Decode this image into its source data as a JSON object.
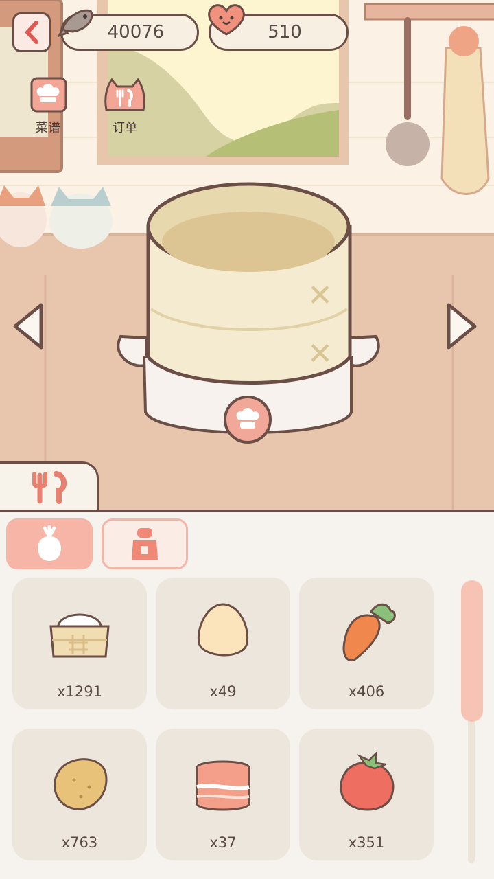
{
  "currency": {
    "fish": {
      "icon": "fish-icon",
      "value": "40076"
    },
    "hearts": {
      "icon": "heart-face-icon",
      "value": "510"
    }
  },
  "top_menu": [
    {
      "icon": "chef-hat-recipe-icon",
      "label": "菜谱"
    },
    {
      "icon": "cat-fork-knife-icon",
      "label": "订单"
    }
  ],
  "cooker": {
    "icon": "steamer-basket-icon",
    "button_icon": "chef-hat-icon"
  },
  "nav": {
    "prev_icon": "arrow-left-icon",
    "next_icon": "arrow-right-icon"
  },
  "cook_tab": {
    "icon": "fork-spoon-icon"
  },
  "category_tabs": [
    {
      "icon": "vegetable-icon",
      "active": true
    },
    {
      "icon": "seasoning-jar-icon",
      "active": false
    }
  ],
  "ingredients": [
    {
      "icon": "flour-basket-icon",
      "qty": "x1291"
    },
    {
      "icon": "egg-icon",
      "qty": "x49"
    },
    {
      "icon": "carrot-icon",
      "qty": "x406"
    },
    {
      "icon": "potato-icon",
      "qty": "x763"
    },
    {
      "icon": "bacon-icon",
      "qty": "x37"
    },
    {
      "icon": "tomato-icon",
      "qty": "x351"
    }
  ],
  "scroll_position": 0,
  "colors": {
    "outline": "#6b4f46",
    "accent": "#f7b5a7",
    "floor": "#e8c6ae",
    "wall": "#fbf1e4"
  }
}
